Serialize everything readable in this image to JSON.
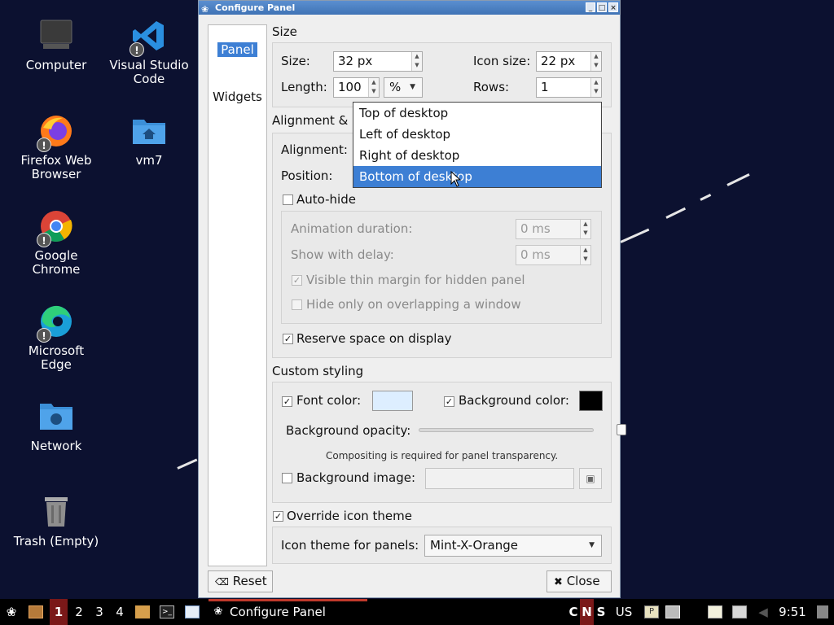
{
  "desktop": {
    "icons": [
      {
        "label": "Computer",
        "icon": "monitor-icon"
      },
      {
        "label": "Visual Studio Code",
        "icon": "vscode-icon"
      },
      {
        "label": "Firefox Web Browser",
        "icon": "firefox-icon"
      },
      {
        "label": "vm7",
        "icon": "home-folder-icon"
      },
      {
        "label": "Google Chrome",
        "icon": "chrome-icon"
      },
      {
        "label": "Microsoft Edge",
        "icon": "edge-icon"
      },
      {
        "label": "Network",
        "icon": "network-folder-icon"
      },
      {
        "label": "Trash (Empty)",
        "icon": "trash-icon"
      }
    ],
    "warning_glyph": "!"
  },
  "window": {
    "title": "Configure Panel",
    "controls": [
      "_",
      "□",
      "×"
    ]
  },
  "tabs": {
    "panel": "Panel",
    "widgets": "Widgets"
  },
  "size": {
    "heading": "Size",
    "size_label": "Size:",
    "size_value": "32 px",
    "icon_size_label": "Icon size:",
    "icon_size_value": "22 px",
    "length_label": "Length:",
    "length_value": "100",
    "length_unit": "%",
    "rows_label": "Rows:",
    "rows_value": "1"
  },
  "alignment": {
    "heading": "Alignment & p",
    "alignment_label": "Alignment:",
    "position_label": "Position:",
    "position_options": [
      "Top of desktop",
      "Left of desktop",
      "Right of desktop",
      "Bottom of desktop"
    ],
    "selected_index": 3
  },
  "autohide": {
    "label": "Auto-hide",
    "checked": false,
    "animation_label": "Animation duration:",
    "animation_value": "0 ms",
    "delay_label": "Show with delay:",
    "delay_value": "0 ms",
    "thin_margin_label": "Visible thin margin for hidden panel",
    "thin_margin_checked": true,
    "overlap_label": "Hide only on overlapping a window",
    "overlap_checked": false,
    "reserve_label": "Reserve space on display",
    "reserve_checked": true
  },
  "styling": {
    "heading": "Custom styling",
    "font_color_label": "Font color:",
    "font_color_checked": true,
    "font_color": "#ddeeff",
    "bg_color_label": "Background color:",
    "bg_color_checked": true,
    "bg_color": "#000000",
    "opacity_label": "Background opacity:",
    "opacity_value": 0,
    "compositing_note": "Compositing is required for panel transparency.",
    "bg_image_label": "Background image:",
    "bg_image_checked": false,
    "bg_image_value": ""
  },
  "icon_theme": {
    "override_label": "Override icon theme",
    "override_checked": true,
    "theme_label": "Icon theme for panels:",
    "theme_value": "Mint-X-Orange"
  },
  "buttons": {
    "reset": "Reset",
    "close": "Close"
  },
  "taskbar": {
    "workspaces": [
      "1",
      "2",
      "3",
      "4"
    ],
    "active_workspace": "1",
    "task_label": "Configure Panel",
    "locks": [
      "C",
      "N",
      "S"
    ],
    "keyboard_layout": "US",
    "clock": "9:51"
  }
}
